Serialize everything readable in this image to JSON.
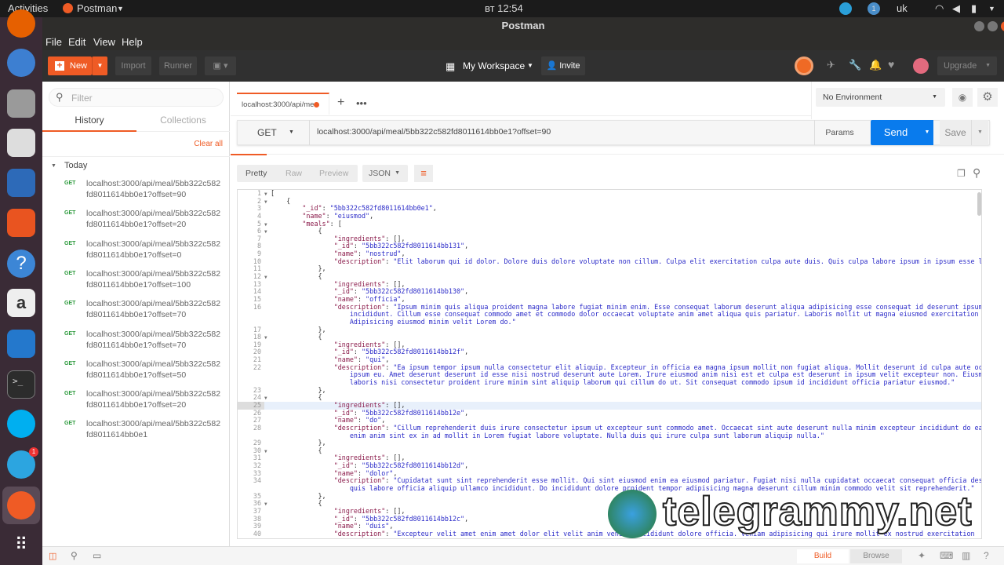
{
  "os": {
    "activities": "Activities",
    "app_menu": "Postman",
    "clock": "вт 12:54",
    "lang": "uk",
    "notif_count": "1",
    "telegram_badge": "1"
  },
  "window": {
    "title": "Postman"
  },
  "menu": [
    "File",
    "Edit",
    "View",
    "Help"
  ],
  "toolbar": {
    "new": "New",
    "import": "Import",
    "runner": "Runner",
    "workspace": "My Workspace",
    "invite": "Invite",
    "upgrade": "Upgrade"
  },
  "sidebar": {
    "filter_placeholder": "Filter",
    "tabs": [
      "History",
      "Collections"
    ],
    "clear_all": "Clear all",
    "group": "Today",
    "items": [
      {
        "method": "GET",
        "l1": "localhost:3000/api/meal/5bb322c582",
        "l2": "fd8011614bb0e1?offset=90"
      },
      {
        "method": "GET",
        "l1": "localhost:3000/api/meal/5bb322c582",
        "l2": "fd8011614bb0e1?offset=20"
      },
      {
        "method": "GET",
        "l1": "localhost:3000/api/meal/5bb322c582",
        "l2": "fd8011614bb0e1?offset=0"
      },
      {
        "method": "GET",
        "l1": "localhost:3000/api/meal/5bb322c582",
        "l2": "fd8011614bb0e1?offset=100"
      },
      {
        "method": "GET",
        "l1": "localhost:3000/api/meal/5bb322c582",
        "l2": "fd8011614bb0e1?offset=70"
      },
      {
        "method": "GET",
        "l1": "localhost:3000/api/meal/5bb322c582",
        "l2": "fd8011614bb0e1?offset=70"
      },
      {
        "method": "GET",
        "l1": "localhost:3000/api/meal/5bb322c582",
        "l2": "fd8011614bb0e1?offset=50"
      },
      {
        "method": "GET",
        "l1": "localhost:3000/api/meal/5bb322c582",
        "l2": "fd8011614bb0e1?offset=20"
      },
      {
        "method": "GET",
        "l1": "localhost:3000/api/meal/5bb322c582",
        "l2": "fd8011614bb0e1"
      }
    ]
  },
  "request": {
    "tab_label": "localhost:3000/api/me",
    "method": "GET",
    "url": "localhost:3000/api/meal/5bb322c582fd8011614bb0e1?offset=90",
    "params": "Params",
    "send": "Send",
    "save": "Save",
    "environment": "No Environment"
  },
  "response": {
    "views": [
      "Pretty",
      "Raw",
      "Preview"
    ],
    "format": "JSON",
    "lines": [
      {
        "n": "1",
        "f": true,
        "t": "["
      },
      {
        "n": "2",
        "f": true,
        "t": "    {"
      },
      {
        "n": "3",
        "t": "        \"_id\": \"5bb322c582fd8011614bb0e1\","
      },
      {
        "n": "4",
        "t": "        \"name\": \"eiusmod\","
      },
      {
        "n": "5",
        "f": true,
        "t": "        \"meals\": ["
      },
      {
        "n": "6",
        "f": true,
        "t": "            {"
      },
      {
        "n": "7",
        "t": "                \"ingredients\": [],"
      },
      {
        "n": "8",
        "t": "                \"_id\": \"5bb322c582fd8011614bb131\","
      },
      {
        "n": "9",
        "t": "                \"name\": \"nostrud\","
      },
      {
        "n": "10",
        "t": "                \"description\": \"Elit laborum qui id dolor. Dolore duis dolore voluptate non cillum. Culpa elit exercitation culpa aute duis. Quis culpa labore ipsum in ipsum esse labore.\""
      },
      {
        "n": "11",
        "t": "            },"
      },
      {
        "n": "12",
        "f": true,
        "t": "            {"
      },
      {
        "n": "13",
        "t": "                \"ingredients\": [],"
      },
      {
        "n": "14",
        "t": "                \"_id\": \"5bb322c582fd8011614bb130\","
      },
      {
        "n": "15",
        "t": "                \"name\": \"officia\","
      },
      {
        "n": "16",
        "t": "                \"description\": \"Ipsum minim quis aliqua proident magna labore fugiat minim enim. Esse consequat laborum deserunt aliqua adipisicing esse consequat id deserunt ipsum"
      },
      {
        "n": "",
        "c": true,
        "t": "                    incididunt. Cillum esse consequat commodo amet et commodo dolor occaecat voluptate anim amet aliqua quis pariatur. Laboris mollit ut magna eiusmod exercitation minim."
      },
      {
        "n": "",
        "c": true,
        "t": "                    Adipisicing eiusmod minim velit Lorem do.\""
      },
      {
        "n": "17",
        "t": "            },"
      },
      {
        "n": "18",
        "f": true,
        "t": "            {"
      },
      {
        "n": "19",
        "t": "                \"ingredients\": [],"
      },
      {
        "n": "20",
        "t": "                \"_id\": \"5bb322c582fd8011614bb12f\","
      },
      {
        "n": "21",
        "t": "                \"name\": \"qui\","
      },
      {
        "n": "22",
        "t": "                \"description\": \"Ea ipsum tempor ipsum nulla consectetur elit aliquip. Excepteur in officia ea magna ipsum mollit non fugiat aliqua. Mollit deserunt id culpa aute occaecat"
      },
      {
        "n": "",
        "c": true,
        "t": "                    ipsum eu. Amet deserunt deserunt id esse nisi nostrud deserunt aute Lorem. Irure eiusmod anim nisi est et culpa est deserunt in ipsum velit excepteur non. Eiusmod"
      },
      {
        "n": "",
        "c": true,
        "t": "                    laboris nisi consectetur proident irure minim sint aliquip laborum qui cillum do ut. Sit consequat commodo ipsum id incididunt officia pariatur eiusmod.\""
      },
      {
        "n": "23",
        "t": "            },"
      },
      {
        "n": "24",
        "f": true,
        "t": "            {"
      },
      {
        "n": "25",
        "a": true,
        "t": "                \"ingredients\": [],"
      },
      {
        "n": "26",
        "t": "                \"_id\": \"5bb322c582fd8011614bb12e\","
      },
      {
        "n": "27",
        "t": "                \"name\": \"do\","
      },
      {
        "n": "28",
        "t": "                \"description\": \"Cillum reprehenderit duis irure consectetur ipsum ut excepteur sunt commodo amet. Occaecat sint aute deserunt nulla minim excepteur incididunt do ea. Aute"
      },
      {
        "n": "",
        "c": true,
        "t": "                    enim anim sint ex in ad mollit in Lorem fugiat labore voluptate. Nulla duis qui irure culpa sunt laborum aliquip nulla.\""
      },
      {
        "n": "29",
        "t": "            },"
      },
      {
        "n": "30",
        "f": true,
        "t": "            {"
      },
      {
        "n": "31",
        "t": "                \"ingredients\": [],"
      },
      {
        "n": "32",
        "t": "                \"_id\": \"5bb322c582fd8011614bb12d\","
      },
      {
        "n": "33",
        "t": "                \"name\": \"dolor\","
      },
      {
        "n": "34",
        "t": "                \"description\": \"Cupidatat sunt sint reprehenderit esse mollit. Qui sint eiusmod enim ea eiusmod pariatur. Fugiat nisi nulla cupidatat occaecat consequat officia deserunt"
      },
      {
        "n": "",
        "c": true,
        "t": "                    quis labore officia aliquip ullamco incididunt. Do incididunt dolore proident tempor adipisicing magna deserunt cillum minim commodo velit sit reprehenderit.\""
      },
      {
        "n": "35",
        "t": "            },"
      },
      {
        "n": "36",
        "f": true,
        "t": "            {"
      },
      {
        "n": "37",
        "t": "                \"ingredients\": [],"
      },
      {
        "n": "38",
        "t": "                \"_id\": \"5bb322c582fd8011614bb12c\","
      },
      {
        "n": "39",
        "t": "                \"name\": \"duis\","
      },
      {
        "n": "40",
        "t": "                \"description\": \"Excepteur velit amet enim amet dolor elit velit anim veniam incididunt dolore officia. Veniam adipisicing qui irure mollit ex nostrud exercitation"
      }
    ]
  },
  "statusbar": {
    "build": "Build",
    "browse": "Browse"
  },
  "watermark": "telegrammy.net",
  "colors": {
    "accent": "#ef5b25",
    "send": "#097bed"
  }
}
